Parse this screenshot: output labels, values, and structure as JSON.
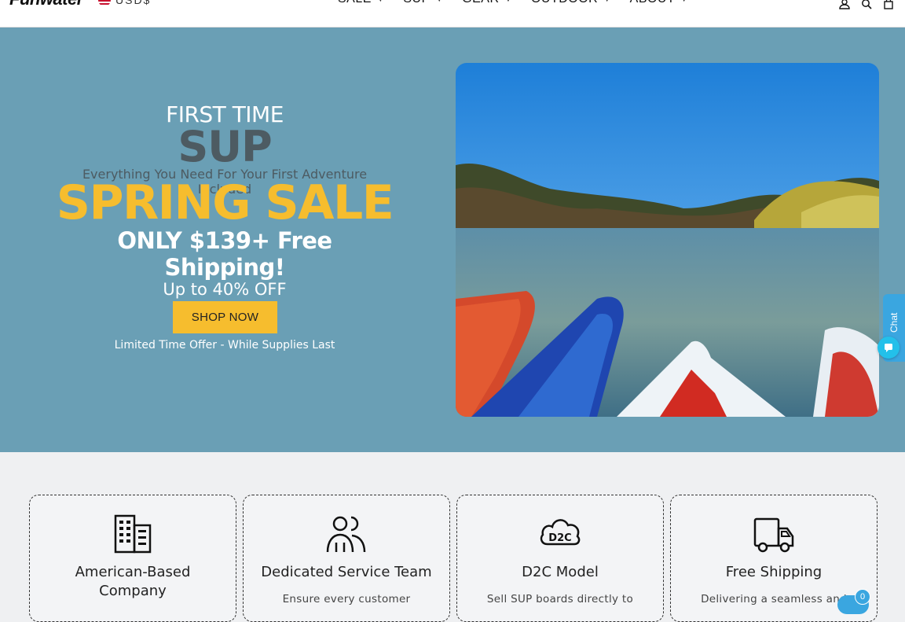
{
  "header": {
    "logo": "Funwater",
    "region": "USD$",
    "nav": [
      {
        "label": "SALE"
      },
      {
        "label": "SUP"
      },
      {
        "label": "GEAR"
      },
      {
        "label": "OUTDOOR"
      },
      {
        "label": "ABOUT"
      }
    ],
    "icons": [
      "account-icon",
      "search-icon",
      "cart-icon"
    ]
  },
  "hero": {
    "line1": "FIRST TIME",
    "line2": "SUP",
    "line3": "Everything You Need For Your First Adventure Included",
    "line4": "SPRING SALE",
    "line5": "ONLY $139+ Free Shipping!",
    "line6": "Up to 40% OFF",
    "cta": "SHOP NOW",
    "note": "Limited Time Offer - While Supplies Last",
    "colors": {
      "background": "#6a9fb5",
      "accent": "#f6bd2e",
      "muted": "#4d5b62"
    }
  },
  "chat": {
    "label": "Chat"
  },
  "features": [
    {
      "icon": "building-icon",
      "title_l1": "American-Based",
      "title_l2": "Company",
      "desc": ""
    },
    {
      "icon": "team-icon",
      "title_l1": "Dedicated Service Team",
      "title_l2": "",
      "desc": "Ensure every customer"
    },
    {
      "icon": "d2c-cloud-icon",
      "icon_text": "D2C",
      "title_l1": "D2C Model",
      "title_l2": "",
      "desc": "Sell SUP boards directly to"
    },
    {
      "icon": "truck-icon",
      "title_l1": "Free Shipping",
      "title_l2": "",
      "desc": "Delivering a seamless and"
    }
  ],
  "cart_badge": "0"
}
